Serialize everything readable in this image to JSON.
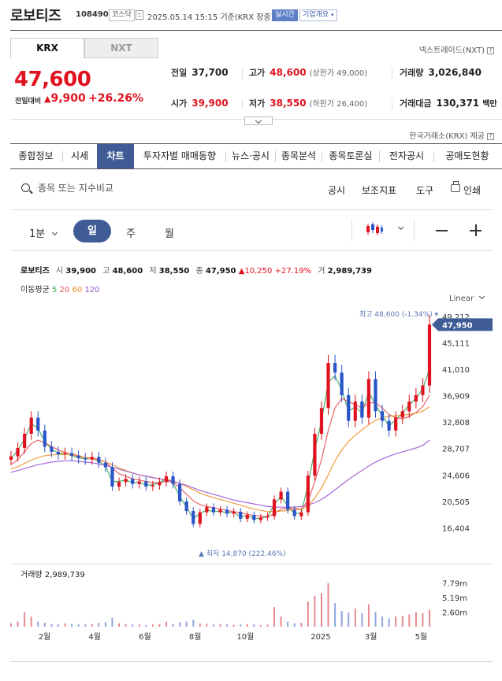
{
  "header": {
    "stock_name": "로보티즈",
    "stock_code": "108490",
    "market_badge": "코스닥",
    "datetime": "2025.05.14 15:15",
    "basis": "기준(KRX 장중)",
    "realtime_label": "실시간",
    "company_label": "기업개요"
  },
  "market_tabs": {
    "krx": "KRX",
    "nxt": "NXT",
    "nxt_provider": "넥스트레이드(NXT)"
  },
  "summary": {
    "price": "47,600",
    "change_label": "전일대비",
    "change_value": "9,900",
    "change_pct": "+26.26%",
    "prev_close_label": "전일",
    "prev_close": "37,700",
    "high_label": "고가",
    "high": "48,600",
    "upper_limit_note": "(상한가 49,000)",
    "volume_label": "거래량",
    "volume": "3,026,840",
    "open_label": "시가",
    "open": "39,900",
    "low_label": "저가",
    "low": "38,550",
    "lower_limit_note": "(하한가 26,400)",
    "amount_label": "거래대금",
    "amount": "130,371",
    "amount_unit": "백만",
    "source": "한국거래소(KRX) 제공"
  },
  "nav": [
    "종합정보",
    "시세",
    "차트",
    "투자자별 매매동향",
    "뉴스·공시",
    "종목분석",
    "종목토론실",
    "전자공시",
    "공매도현황"
  ],
  "toolbar": {
    "search_placeholder": "종목 또는 지수비교",
    "disclosure": "공시",
    "indicator": "보조지표",
    "tools": "도구",
    "print": "인쇄"
  },
  "periods": {
    "minute": "1분",
    "day": "일",
    "week": "주",
    "month": "월"
  },
  "chart_info": {
    "name": "로보티즈",
    "open_label": "시",
    "open": "39,900",
    "high_label": "고",
    "high": "48,600",
    "low_label": "저",
    "low": "38,550",
    "close_label": "종",
    "close": "47,950",
    "change": "10,250",
    "change_pct": "+27.19%",
    "volume_label": "거",
    "volume": "2,989,739",
    "ma_label": "이동평균",
    "ma": [
      {
        "period": "5",
        "color": "#3aa655"
      },
      {
        "period": "20",
        "color": "#e8525a"
      },
      {
        "period": "60",
        "color": "#f0922c"
      },
      {
        "period": "120",
        "color": "#9b59d6"
      }
    ],
    "scale": "Linear",
    "high_marker": "최고 48,600 (-1.34%)",
    "low_marker": "최저 14,870 (222.46%)",
    "current_price_tag": "47,950"
  },
  "chart_data": {
    "type": "candlestick",
    "x": [
      "2월",
      "4월",
      "6월",
      "8월",
      "10월",
      "2025",
      "3월",
      "5월"
    ],
    "y_ticks": [
      "49,212",
      "45,111",
      "41,010",
      "36,909",
      "32,808",
      "28,707",
      "24,606",
      "20,505",
      "16,404"
    ],
    "ylim": [
      14000,
      49212
    ],
    "series": [
      {
        "name": "price",
        "values": [
          27500,
          28800,
          31000,
          33500,
          31500,
          29000,
          28200,
          27800,
          28000,
          27600,
          27200,
          27000,
          27400,
          26500,
          25800,
          22800,
          23500,
          24000,
          23200,
          23600,
          22800,
          23000,
          23500,
          24400,
          23200,
          20500,
          19000,
          17000,
          18800,
          19600,
          18800,
          19200,
          18600,
          18900,
          17800,
          18400,
          17600,
          18000,
          18200,
          20800,
          22000,
          19200,
          18200,
          18800,
          24500,
          31000,
          35000,
          42000,
          40500,
          37000,
          33000,
          36000,
          33500,
          39500,
          34500,
          33000,
          31500,
          33500,
          34500,
          36000,
          37000,
          38500,
          47950
        ]
      },
      {
        "name": "5",
        "values": [
          27200,
          28400,
          30200,
          32600,
          31800,
          29800,
          28600,
          28000,
          27900,
          27600,
          27300,
          27100,
          27200,
          26700,
          26000,
          23500,
          23600,
          23800,
          23400,
          23500,
          23000,
          23100,
          23400,
          24000,
          23400,
          21200,
          19600,
          17800,
          18600,
          19200,
          18900,
          19000,
          18700,
          18800,
          18100,
          18300,
          17800,
          17900,
          18100,
          20000,
          21300,
          19800,
          18600,
          18700,
          23000,
          28500,
          33000,
          39000,
          40000,
          37800,
          34500,
          35200,
          34200,
          37500,
          35500,
          33800,
          32200,
          33200,
          34200,
          35500,
          36500,
          38000,
          41000
        ]
      },
      {
        "name": "20",
        "values": [
          26200,
          27000,
          28200,
          29500,
          30000,
          29600,
          29000,
          28500,
          28100,
          27900,
          27600,
          27300,
          27200,
          27000,
          26600,
          25600,
          24800,
          24400,
          24000,
          23800,
          23600,
          23400,
          23400,
          23600,
          23500,
          22600,
          21600,
          20600,
          20000,
          19700,
          19500,
          19300,
          19100,
          18900,
          18700,
          18500,
          18300,
          18200,
          18100,
          18600,
          19300,
          19500,
          19400,
          19300,
          20600,
          23500,
          27000,
          31500,
          35000,
          36500,
          36000,
          35500,
          35000,
          35800,
          35800,
          35000,
          34000,
          33500,
          33300,
          33700,
          34300,
          35200,
          37000
        ]
      },
      {
        "name": "60",
        "values": [
          25500,
          25900,
          26400,
          26900,
          27300,
          27600,
          27700,
          27800,
          27800,
          27700,
          27500,
          27300,
          27100,
          26900,
          26600,
          26200,
          25700,
          25300,
          24900,
          24600,
          24400,
          24200,
          24000,
          23900,
          23700,
          23300,
          22800,
          22300,
          21800,
          21400,
          21100,
          20800,
          20500,
          20200,
          19900,
          19600,
          19300,
          19100,
          18900,
          18900,
          19000,
          19100,
          19200,
          19300,
          19800,
          21000,
          22600,
          24600,
          26800,
          28500,
          29800,
          30800,
          31600,
          32400,
          33100,
          33500,
          33700,
          33800,
          33900,
          34000,
          34200,
          34500,
          35200
        ]
      },
      {
        "name": "120",
        "values": [
          25000,
          25300,
          25600,
          25900,
          26200,
          26400,
          26600,
          26700,
          26800,
          26800,
          26700,
          26600,
          26500,
          26300,
          26100,
          25800,
          25500,
          25200,
          24900,
          24600,
          24400,
          24200,
          24000,
          23800,
          23600,
          23300,
          23000,
          22600,
          22200,
          21900,
          21600,
          21300,
          21000,
          20700,
          20500,
          20300,
          20100,
          19900,
          19700,
          19600,
          19600,
          19600,
          19600,
          19700,
          19900,
          20300,
          20800,
          21500,
          22300,
          23100,
          23900,
          24600,
          25300,
          26000,
          26600,
          27100,
          27500,
          27900,
          28200,
          28500,
          28800,
          29200,
          30000
        ]
      }
    ],
    "volume": {
      "name": "거래량",
      "y_ticks": [
        "7.79m",
        "5.19m",
        "2.60m"
      ],
      "ylim": [
        0,
        9000000
      ],
      "values": [
        600000,
        900000,
        2600000,
        1800000,
        900000,
        700000,
        500000,
        400000,
        600000,
        500000,
        400000,
        400000,
        500000,
        700000,
        800000,
        1600000,
        600000,
        500000,
        400000,
        400000,
        300000,
        400000,
        500000,
        900000,
        500000,
        800000,
        900000,
        1200000,
        600000,
        500000,
        400000,
        500000,
        400000,
        300000,
        400000,
        500000,
        400000,
        300000,
        400000,
        3500000,
        1800000,
        900000,
        600000,
        700000,
        4500000,
        5500000,
        6000000,
        7800000,
        4200000,
        2800000,
        2500000,
        3200000,
        2400000,
        4000000,
        2600000,
        1800000,
        1500000,
        1800000,
        1900000,
        2200000,
        2600000,
        2400000,
        2989739
      ]
    }
  }
}
